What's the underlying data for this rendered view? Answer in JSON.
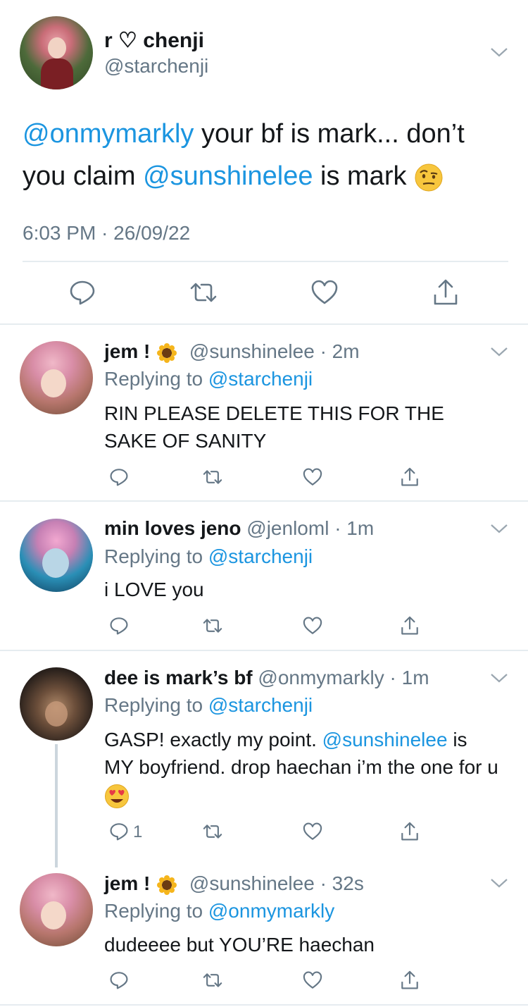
{
  "main_tweet": {
    "display_name": "r ♡ chenji",
    "handle": "@starchenji",
    "text_mention1": "@onmymarkly",
    "text_part1": " your bf is mark... don’t you claim ",
    "text_mention2": "@sunshinelee",
    "text_part2": " is mark ",
    "emoji": "face-with-raised-eyebrow",
    "timestamp": "6:03 PM · 26/09/22"
  },
  "replies": [
    {
      "display_name": "jem ! ",
      "emoji": "sunflower",
      "handle": "@sunshinelee",
      "time": "· 2m",
      "replying_label": "Replying to ",
      "replying_to": "@starchenji",
      "text": "RIN PLEASE DELETE THIS FOR THE SAKE OF SANITY"
    },
    {
      "display_name": "min loves jeno",
      "handle": "@jenloml",
      "time": "· 1m",
      "replying_label": "Replying to ",
      "replying_to": "@starchenji",
      "text": "i LOVE you"
    },
    {
      "display_name": "dee is mark’s bf",
      "handle": "@onmymarkly",
      "time": "· 1m",
      "replying_label": "Replying to ",
      "replying_to": "@starchenji",
      "text_part1": "GASP! exactly my point. ",
      "text_mention": "@sunshinelee",
      "text_part2": " is MY boyfriend. drop haechan i’m the one for u ",
      "emoji": "heart-eyes",
      "reply_count": "1"
    },
    {
      "display_name": "jem ! ",
      "emoji": "sunflower",
      "handle": "@sunshinelee",
      "time": "· 32s",
      "replying_label": "Replying to ",
      "replying_to": "@onmymarkly",
      "text": "dudeeee but YOU’RE haechan"
    }
  ],
  "icons": [
    "chevron-down-icon",
    "reply-icon",
    "retweet-icon",
    "like-icon",
    "share-icon"
  ],
  "colors": {
    "link": "#1b95e0",
    "secondary": "#657786",
    "divider": "#e6ecf0"
  }
}
